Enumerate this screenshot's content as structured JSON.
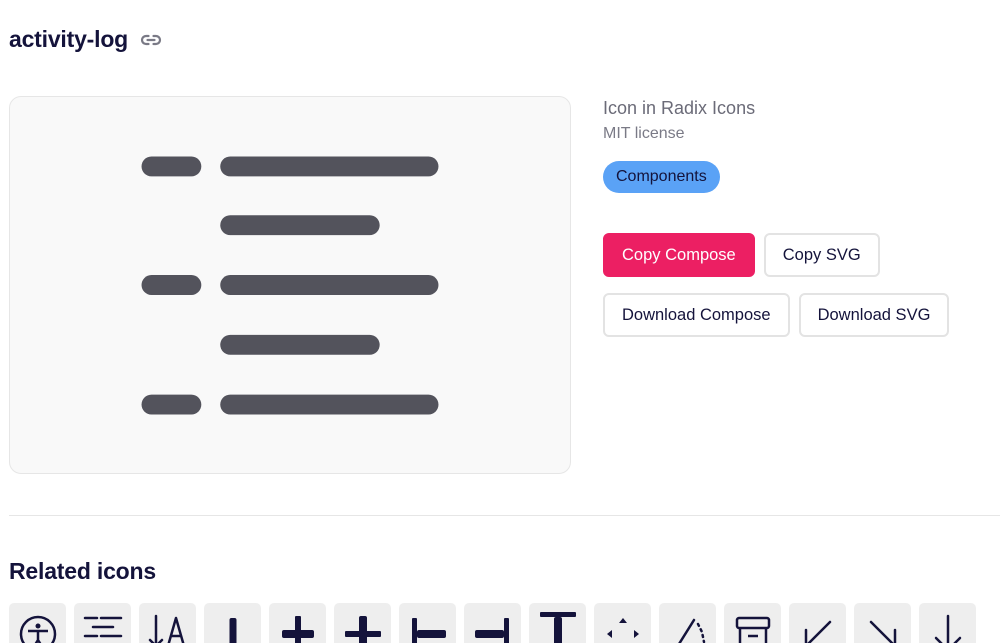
{
  "page": {
    "title": "activity-log"
  },
  "info": {
    "source": "Icon in Radix Icons",
    "license": "MIT license",
    "tag": "Components"
  },
  "actions": {
    "copy_compose": "Copy Compose",
    "copy_svg": "Copy SVG",
    "download_compose": "Download Compose",
    "download_svg": "Download SVG"
  },
  "related": {
    "title": "Related icons",
    "icons": [
      "accessibility-icon",
      "align-center-icon",
      "letter-case-toggle-icon",
      "align-bottom-icon",
      "align-center-horizontally-icon",
      "align-center-vertically-icon",
      "align-left-icon",
      "align-right-icon",
      "align-top-icon",
      "all-sides-icon",
      "angle-icon",
      "archive-icon",
      "arrow-bottom-left-icon",
      "arrow-bottom-right-icon",
      "arrow-down-icon"
    ]
  },
  "colors": {
    "primary": "#ec1f63",
    "tag": "#5aa2f6",
    "text": "#14133b",
    "icon_fill": "#53535c"
  }
}
